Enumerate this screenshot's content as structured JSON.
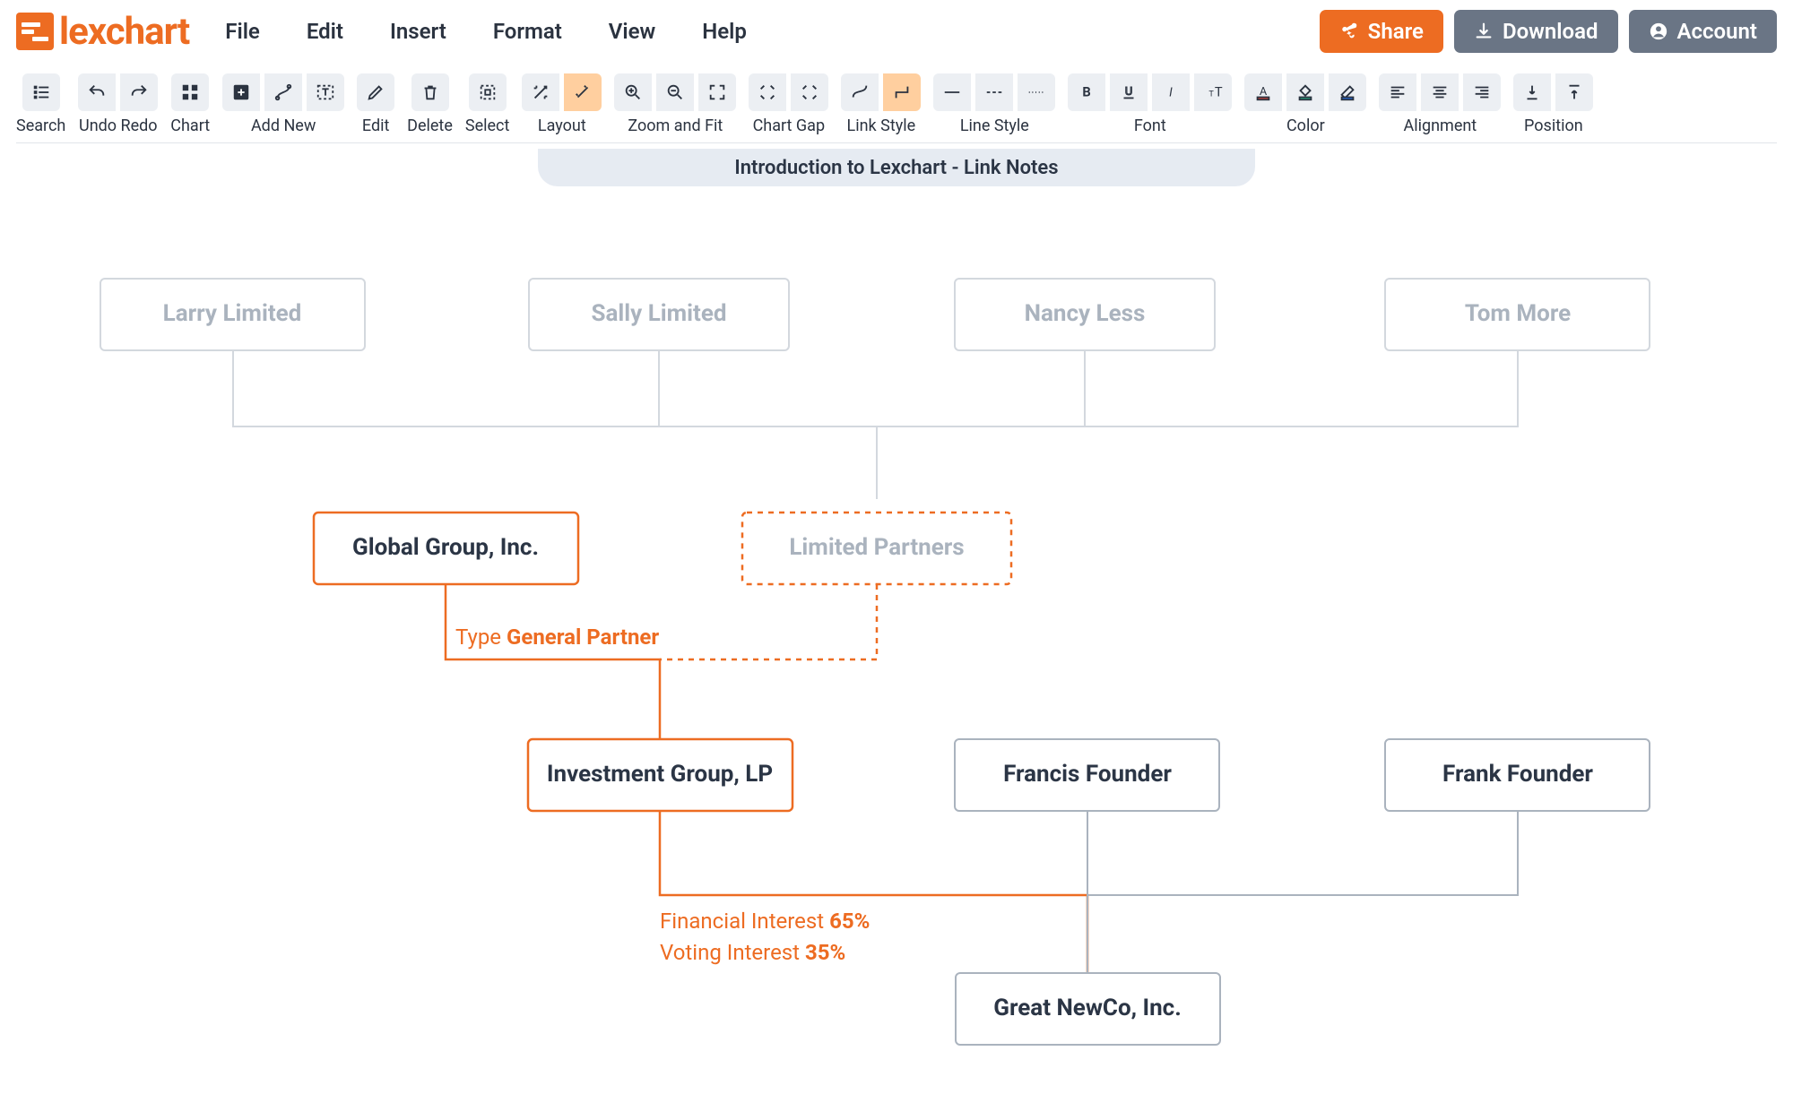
{
  "app": {
    "name": "lexchart"
  },
  "menu": [
    "File",
    "Edit",
    "Insert",
    "Format",
    "View",
    "Help"
  ],
  "top_buttons": {
    "share": "Share",
    "download": "Download",
    "account": "Account"
  },
  "toolbar_groups": {
    "search": "Search",
    "undoredo": "Undo Redo",
    "chart": "Chart",
    "addnew": "Add New",
    "edit": "Edit",
    "delete": "Delete",
    "select": "Select",
    "layout": "Layout",
    "zoomfit": "Zoom and Fit",
    "chartgap": "Chart Gap",
    "linkstyle": "Link Style",
    "linestyle": "Line Style",
    "font": "Font",
    "color": "Color",
    "alignment": "Alignment",
    "position": "Position"
  },
  "chart_title": "Introduction to Lexchart - Link Notes",
  "nodes": {
    "larry": "Larry Limited",
    "sally": "Sally Limited",
    "nancy": "Nancy Less",
    "tom": "Tom More",
    "global": "Global Group, Inc.",
    "lp": "Limited Partners",
    "invest": "Investment Group, LP",
    "francis": "Francis Founder",
    "frank": "Frank Founder",
    "newco": "Great NewCo, Inc."
  },
  "link_notes": {
    "type_key": "Type",
    "type_val": "General Partner",
    "fin_key": "Financial Interest",
    "fin_val": "65%",
    "vote_key": "Voting Interest",
    "vote_val": "35%"
  },
  "chart_data": {
    "type": "org-hierarchy",
    "title": "Introduction to Lexchart - Link Notes",
    "nodes": [
      {
        "id": "larry",
        "label": "Larry Limited"
      },
      {
        "id": "sally",
        "label": "Sally Limited"
      },
      {
        "id": "nancy",
        "label": "Nancy Less"
      },
      {
        "id": "tom",
        "label": "Tom More"
      },
      {
        "id": "global",
        "label": "Global Group, Inc.",
        "selected": true
      },
      {
        "id": "lp",
        "label": "Limited Partners",
        "dashed": true
      },
      {
        "id": "invest",
        "label": "Investment Group, LP",
        "selected": true
      },
      {
        "id": "francis",
        "label": "Francis Founder"
      },
      {
        "id": "frank",
        "label": "Frank Founder"
      },
      {
        "id": "newco",
        "label": "Great NewCo, Inc."
      }
    ],
    "edges": [
      {
        "from": "larry",
        "to": "lp"
      },
      {
        "from": "sally",
        "to": "lp"
      },
      {
        "from": "nancy",
        "to": "lp"
      },
      {
        "from": "tom",
        "to": "lp"
      },
      {
        "from": "global",
        "to": "invest",
        "notes": {
          "Type": "General Partner"
        },
        "selected": true
      },
      {
        "from": "lp",
        "to": "invest",
        "dashed": true
      },
      {
        "from": "invest",
        "to": "newco",
        "notes": {
          "Financial Interest": "65%",
          "Voting Interest": "35%"
        },
        "selected": true
      },
      {
        "from": "francis",
        "to": "newco"
      },
      {
        "from": "frank",
        "to": "newco"
      }
    ]
  }
}
